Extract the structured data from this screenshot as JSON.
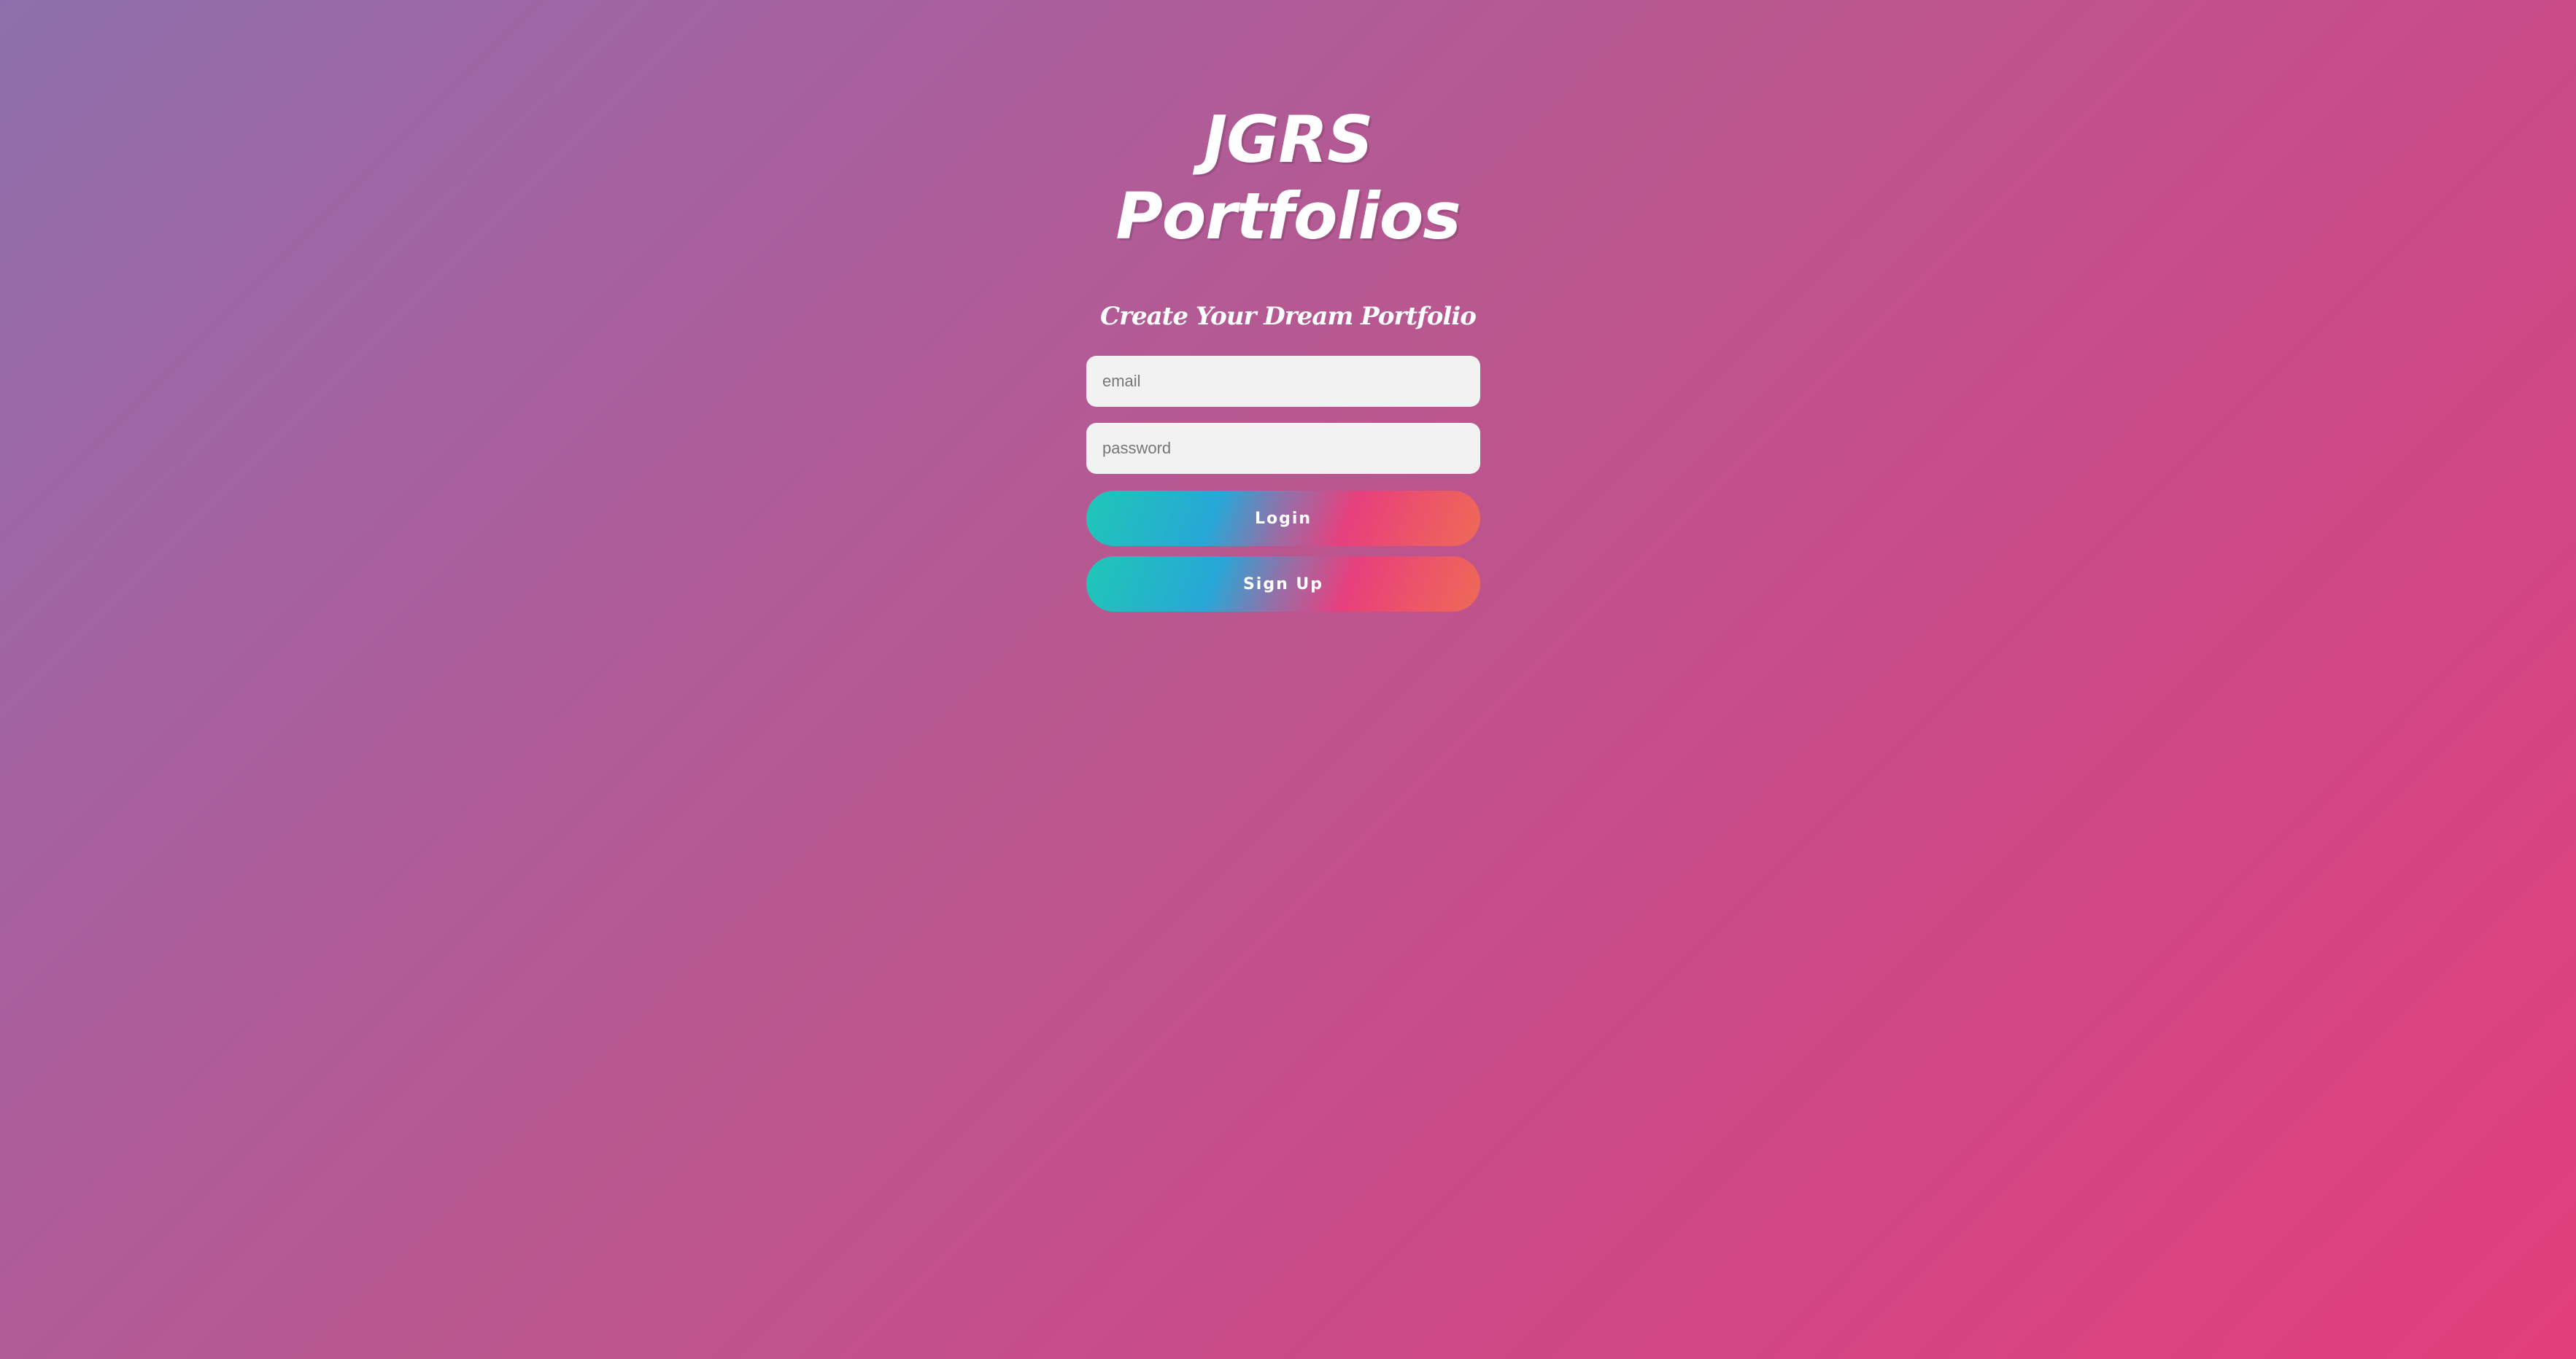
{
  "header": {
    "title_line1": "JGRS",
    "title_line2": "Portfolios",
    "subtitle": "Create Your Dream Portfolio"
  },
  "form": {
    "email_placeholder": "email",
    "email_value": "",
    "password_placeholder": "password",
    "password_value": "",
    "login_label": "Login",
    "signup_label": "Sign Up"
  },
  "colors": {
    "background_start": "#8d70ab",
    "background_end": "#e2407c",
    "button_teal": "#1fc7b6",
    "button_blue": "#27a7d7",
    "button_pink": "#e83f7d",
    "button_orange": "#ef6a56",
    "input_bg": "#f2f2f2"
  }
}
